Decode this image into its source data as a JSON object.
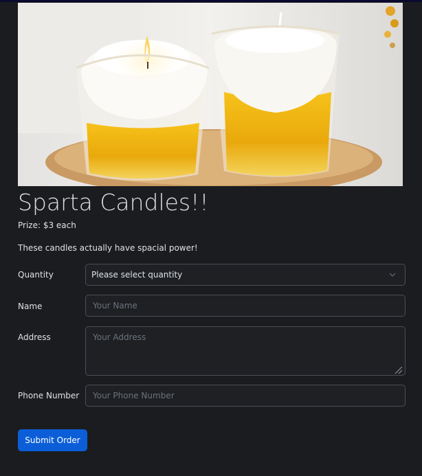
{
  "product": {
    "title": "Sparta Candles!!",
    "price": "Prize: $3 each",
    "description": "These candles actually have spacial power!"
  },
  "form": {
    "quantity": {
      "label": "Quantity",
      "selected": "Please select quantity"
    },
    "name": {
      "label": "Name",
      "placeholder": "Your Name"
    },
    "address": {
      "label": "Address",
      "placeholder": "Your Address"
    },
    "phone": {
      "label": "Phone Number",
      "placeholder": "Your Phone Number"
    },
    "submit_label": "Submit Order"
  },
  "colors": {
    "background": "#1b1c1f",
    "text": "#dee2e6",
    "input_border": "#4a4e55",
    "accent": "#0b5ed7"
  },
  "icons": {
    "select_chevron": "chevron-down-icon",
    "textarea_resize": "resize-grip-icon"
  }
}
